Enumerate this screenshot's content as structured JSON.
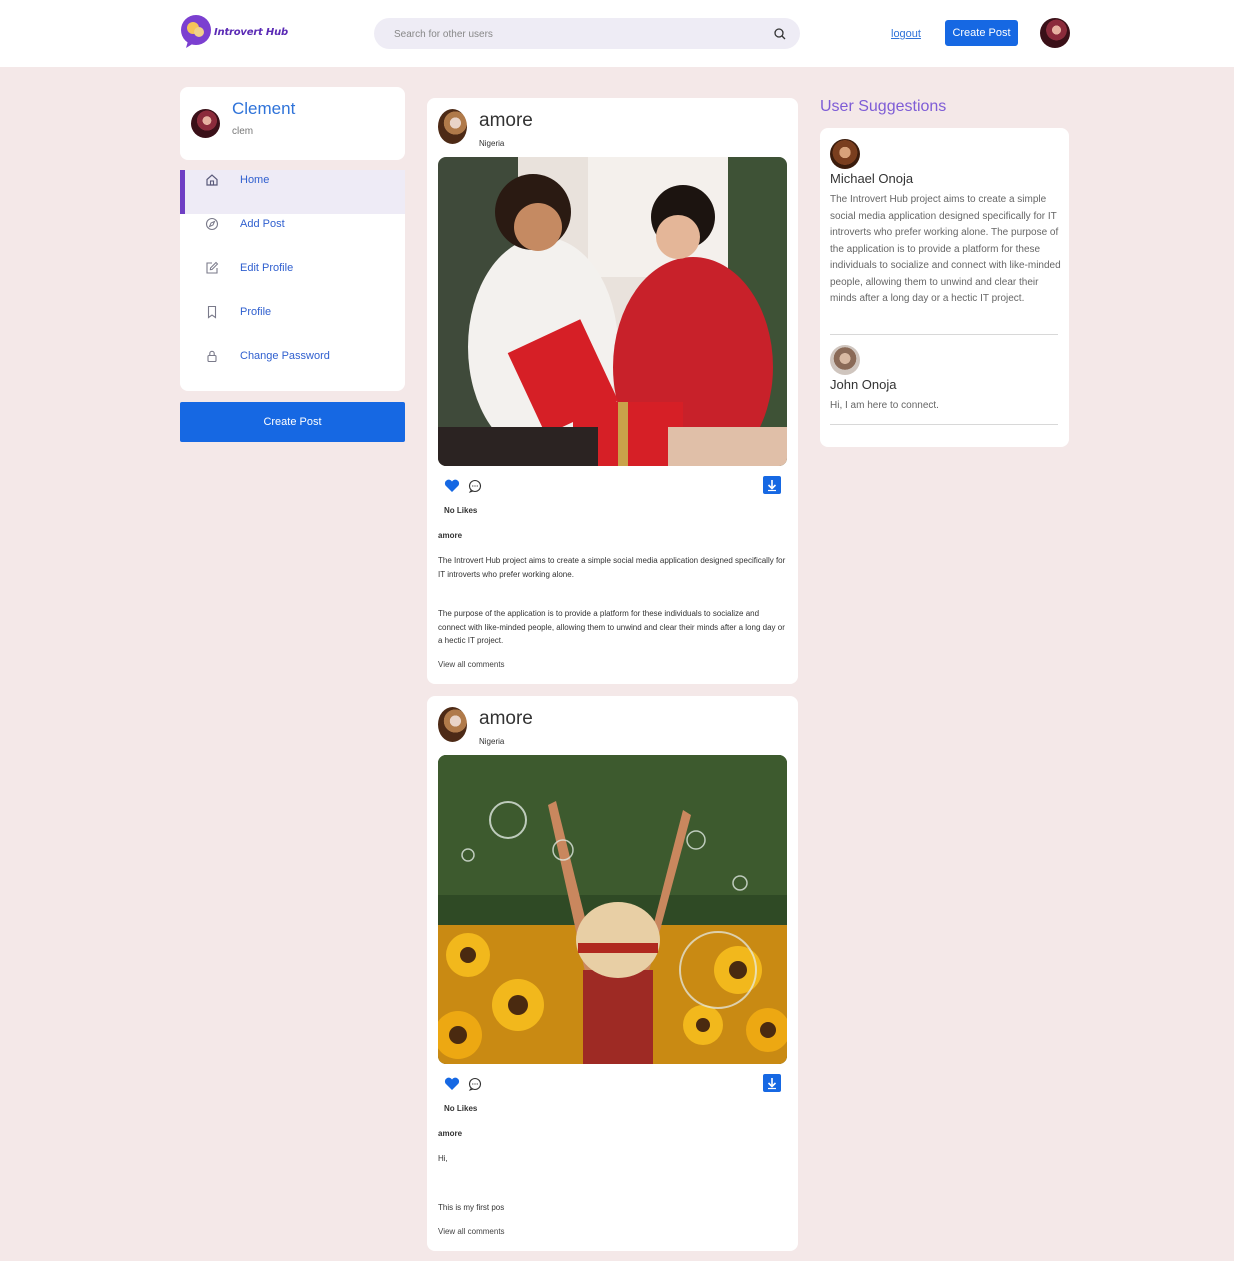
{
  "header": {
    "logo_text": "Introvert Hub",
    "search_placeholder": "Search for other users",
    "logout_label": "logout",
    "create_post_label": "Create Post"
  },
  "profile": {
    "name": "Clement",
    "handle": "clem"
  },
  "nav": {
    "items": [
      {
        "label": "Home",
        "icon": "home-icon",
        "active": true
      },
      {
        "label": "Add Post",
        "icon": "compass-icon",
        "active": false
      },
      {
        "label": "Edit Profile",
        "icon": "edit-icon",
        "active": false
      },
      {
        "label": "Profile",
        "icon": "bookmark-icon",
        "active": false
      },
      {
        "label": "Change Password",
        "icon": "lock-icon",
        "active": false
      }
    ],
    "create_post_label": "Create Post"
  },
  "posts": [
    {
      "username": "amore",
      "location": "Nigeria",
      "likes_text": "No Likes",
      "title": "amore",
      "paragraphs": [
        "The Introvert Hub project aims to create a simple social media application designed specifically for IT introverts who prefer working alone.",
        "The purpose of the application is to provide a platform for these individuals to socialize and connect with like-minded people, allowing them to unwind and clear their minds after a long day or a hectic IT project."
      ],
      "view_comments": "View all comments"
    },
    {
      "username": "amore",
      "location": "Nigeria",
      "likes_text": "No Likes",
      "title": "amore",
      "paragraphs": [
        "Hi,",
        "This is my first pos"
      ],
      "view_comments": "View all comments"
    }
  ],
  "suggestions": {
    "title": "User Suggestions",
    "users": [
      {
        "name": "Michael Onoja",
        "bio": "The Introvert Hub project aims to create a simple social media application designed specifically for IT introverts who prefer working alone. The purpose of the application is to provide a platform for these individuals to socialize and connect with like-minded people, allowing them to unwind and clear their minds after a long day or a hectic IT project."
      },
      {
        "name": "John Onoja",
        "bio": "Hi, I am here to connect."
      }
    ]
  },
  "colors": {
    "accent_blue": "#1668e3",
    "brand_purple": "#6f3fc4",
    "page_bg": "#f4e8e8"
  }
}
